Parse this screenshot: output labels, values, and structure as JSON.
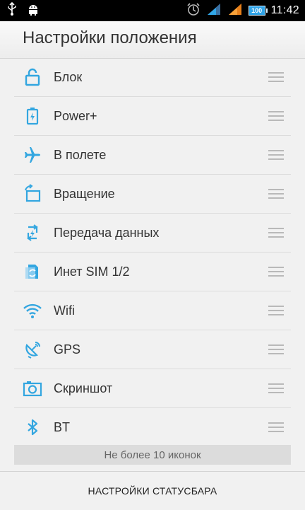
{
  "status_bar": {
    "time": "11:42",
    "battery": "100",
    "icons": [
      "usb-icon",
      "android-debug-icon",
      "alarm-icon",
      "signal-icon",
      "signal-icon",
      "battery-icon"
    ]
  },
  "header": {
    "title": "Настройки положения"
  },
  "items": [
    {
      "label": "Блок",
      "icon": "lock-icon"
    },
    {
      "label": "Power+",
      "icon": "battery-power-icon"
    },
    {
      "label": "В полете",
      "icon": "airplane-icon"
    },
    {
      "label": "Вращение",
      "icon": "rotation-icon"
    },
    {
      "label": "Передача данных",
      "icon": "data-transfer-icon"
    },
    {
      "label": "Инет SIM 1/2",
      "icon": "sim-icon"
    },
    {
      "label": "Wifi",
      "icon": "wifi-icon"
    },
    {
      "label": "GPS",
      "icon": "gps-icon"
    },
    {
      "label": "Скриншот",
      "icon": "camera-icon"
    },
    {
      "label": "BT",
      "icon": "bluetooth-icon"
    }
  ],
  "limit_text": "Не более 10 иконок",
  "footer": {
    "button_label": "НАСТРОЙКИ СТАТУСБАРА"
  },
  "colors": {
    "accent": "#33a6e0",
    "text": "#333333",
    "status_bar": "#000000"
  }
}
